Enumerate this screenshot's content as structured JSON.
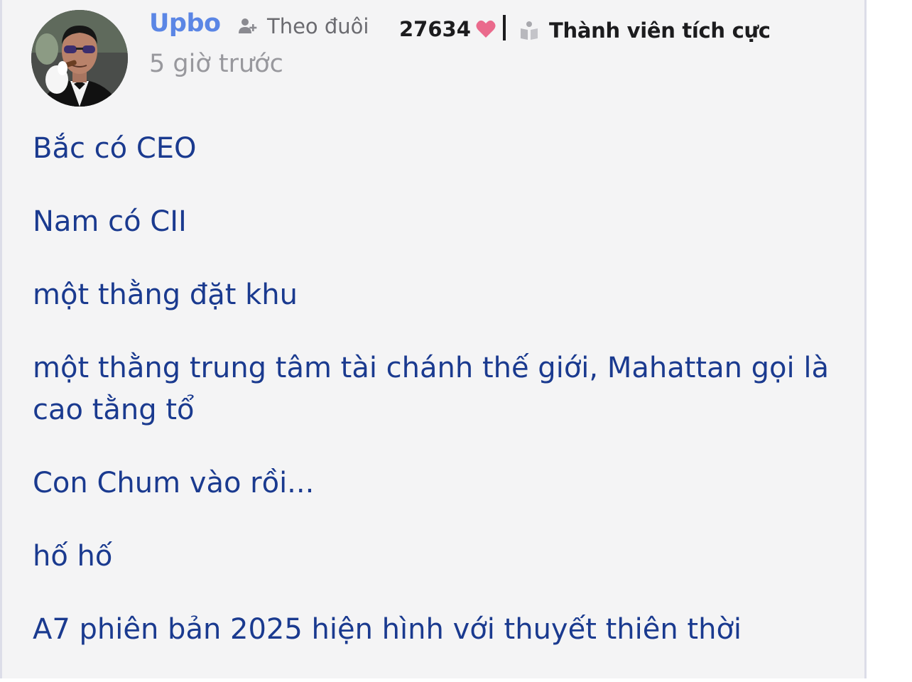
{
  "author": {
    "name": "Upbo",
    "avatar_icon": "avatar-man-with-cigar"
  },
  "follow": {
    "label": "Theo đuôi",
    "icon": "person-add-icon"
  },
  "likes": {
    "count": "27634",
    "icon": "heart-icon",
    "color": "#ea6a8c"
  },
  "badge": {
    "label": "Thành viên tích cực",
    "icon": "badge-icon"
  },
  "timestamp": "5 giờ trước",
  "post": {
    "lines": [
      "Bắc có CEO",
      "Nam có CII",
      "một thằng đặt khu",
      "một thằng trung tâm tài chánh thế giới, Mahattan gọi là cao tằng tổ",
      "Con Chum vào rồi...",
      "hố hố",
      "A7 phiên bản 2025 hiện hình với thuyết thiên thời"
    ]
  },
  "colors": {
    "author_name": "#5b86e5",
    "post_text": "#1a3a8f",
    "card_background": "#f4f4f5"
  }
}
